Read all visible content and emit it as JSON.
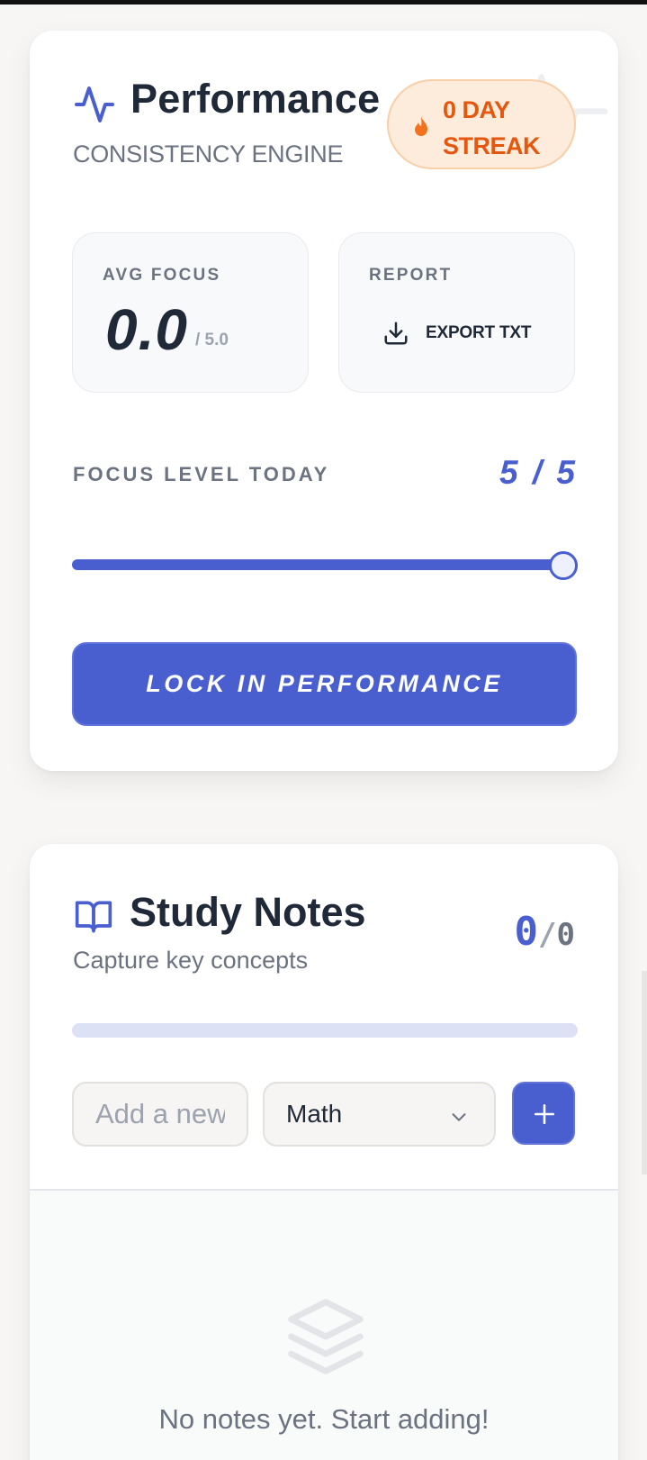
{
  "performance": {
    "title": "Performance",
    "subtitle": "CONSISTENCY ENGINE",
    "streak": {
      "text": "0 DAY STREAK",
      "icon": "flame-icon"
    },
    "avg_focus": {
      "label": "AVG FOCUS",
      "value": "0.0",
      "max": "/ 5.0"
    },
    "report": {
      "label": "REPORT",
      "export_label": "EXPORT TXT",
      "icon": "download-icon"
    },
    "focus_today": {
      "label": "FOCUS LEVEL TODAY",
      "value_text": "5 / 5",
      "value": 5,
      "max": 5
    },
    "lock_button": "LOCK IN PERFORMANCE"
  },
  "notes": {
    "title": "Study Notes",
    "subtitle": "Capture key concepts",
    "count": "0",
    "count_separator": "/",
    "count_total": "0",
    "progress": 0,
    "input_placeholder": "Add a new",
    "subject_selected": "Math",
    "add_button_icon": "plus-icon",
    "empty_icon": "layers-icon",
    "empty_text": "No notes yet. Start adding!"
  },
  "colors": {
    "accent": "#4a5fcf",
    "streak_text": "#e4570f",
    "streak_bg": "#fdebdc",
    "muted_text": "#6b7280",
    "page_bg": "#f7f6f4"
  }
}
